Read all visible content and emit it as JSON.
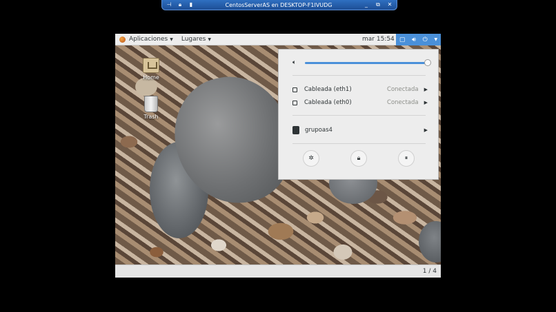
{
  "connection_bar": {
    "title": "CentosServerAS en DESKTOP-F1IVUDG",
    "left_icons": [
      "pin-icon",
      "lock-icon",
      "signal-icon"
    ],
    "right_icons": [
      "minimize-icon",
      "restore-icon",
      "close-icon"
    ]
  },
  "topbar": {
    "applications_label": "Aplicaciones",
    "places_label": "Lugares",
    "clock": "mar 15:54",
    "tray_icons": [
      "network-icon",
      "volume-icon",
      "power-icon",
      "chevron-down-icon"
    ]
  },
  "desktop": {
    "icons": [
      {
        "label": "Home"
      },
      {
        "label": "Trash"
      }
    ]
  },
  "system_menu": {
    "volume_level": 1.0,
    "networks": [
      {
        "label": "Cableada (eth1)",
        "status": "Conectada"
      },
      {
        "label": "Cableada (eth0)",
        "status": "Conectada"
      }
    ],
    "user": {
      "label": "grupoas4"
    },
    "actions": [
      "settings-icon",
      "lock-icon",
      "pause-icon"
    ]
  },
  "bottombar": {
    "workspace": "1 / 4"
  }
}
